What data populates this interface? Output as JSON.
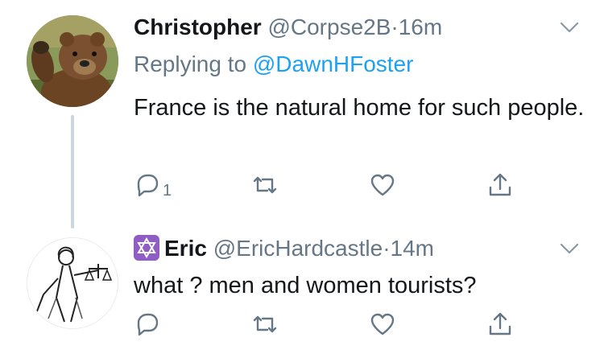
{
  "tweets": [
    {
      "display_name": "Christopher",
      "handle": "@Corpse2B",
      "dot": "·",
      "time": "16m",
      "replying_prefix": "Replying to ",
      "replying_to": "@DawnHFoster",
      "text": "France is the natural home for such people.",
      "reply_count": "1",
      "avatar_icon": "bear-avatar-icon"
    },
    {
      "badge_icon": "star-of-david-icon",
      "display_name": "Eric",
      "handle": "@EricHardcastle",
      "dot": "·",
      "time": "14m",
      "text": "what ? men and women tourists?",
      "reply_count": "",
      "avatar_icon": "lady-justice-avatar-icon"
    }
  ],
  "colors": {
    "primary_text": "#14171a",
    "secondary_text": "#657786",
    "link": "#1da1f2",
    "thread_line": "#ccd6dd",
    "badge": "#8f5dc4"
  }
}
